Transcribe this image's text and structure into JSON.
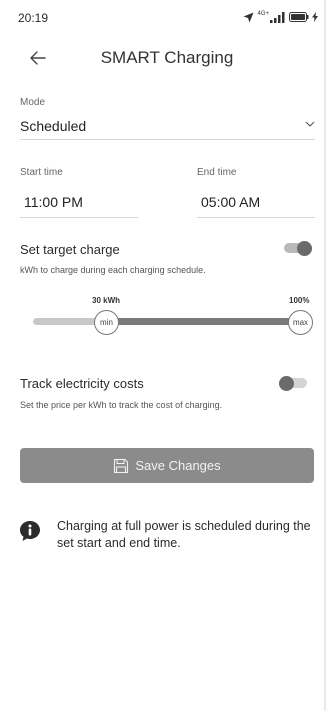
{
  "status_bar": {
    "time": "20:19",
    "network_label": "4G+",
    "icons": [
      "location-arrow-icon",
      "signal-icon",
      "battery-icon",
      "charging-bolt-icon"
    ]
  },
  "header": {
    "title": "SMART Charging",
    "back_icon": "arrow-left-icon"
  },
  "mode": {
    "label": "Mode",
    "value": "Scheduled",
    "icon": "chevron-down-icon"
  },
  "schedule": {
    "start_label": "Start time",
    "start_value": "11:00 PM",
    "end_label": "End time",
    "end_value": "05:00 AM"
  },
  "target_charge": {
    "title": "Set target charge",
    "description": "kWh to charge during each charging schedule.",
    "enabled": true,
    "min_value_label": "30 kWh",
    "max_value_label": "100%",
    "min_handle_label": "min",
    "max_handle_label": "max"
  },
  "track_costs": {
    "title": "Track electricity costs",
    "description": "Set the price per kWh to track the cost of charging.",
    "enabled": false
  },
  "save_button": {
    "label": "Save Changes",
    "icon": "floppy-disk-icon"
  },
  "info": {
    "icon": "info-chat-icon",
    "text": "Charging at full power is scheduled during the set start and end time."
  },
  "colors": {
    "toggle_on_knob": "#6a6a6a",
    "slider_fill": "#7a7a7a",
    "button_bg": "#8b8b8b"
  }
}
